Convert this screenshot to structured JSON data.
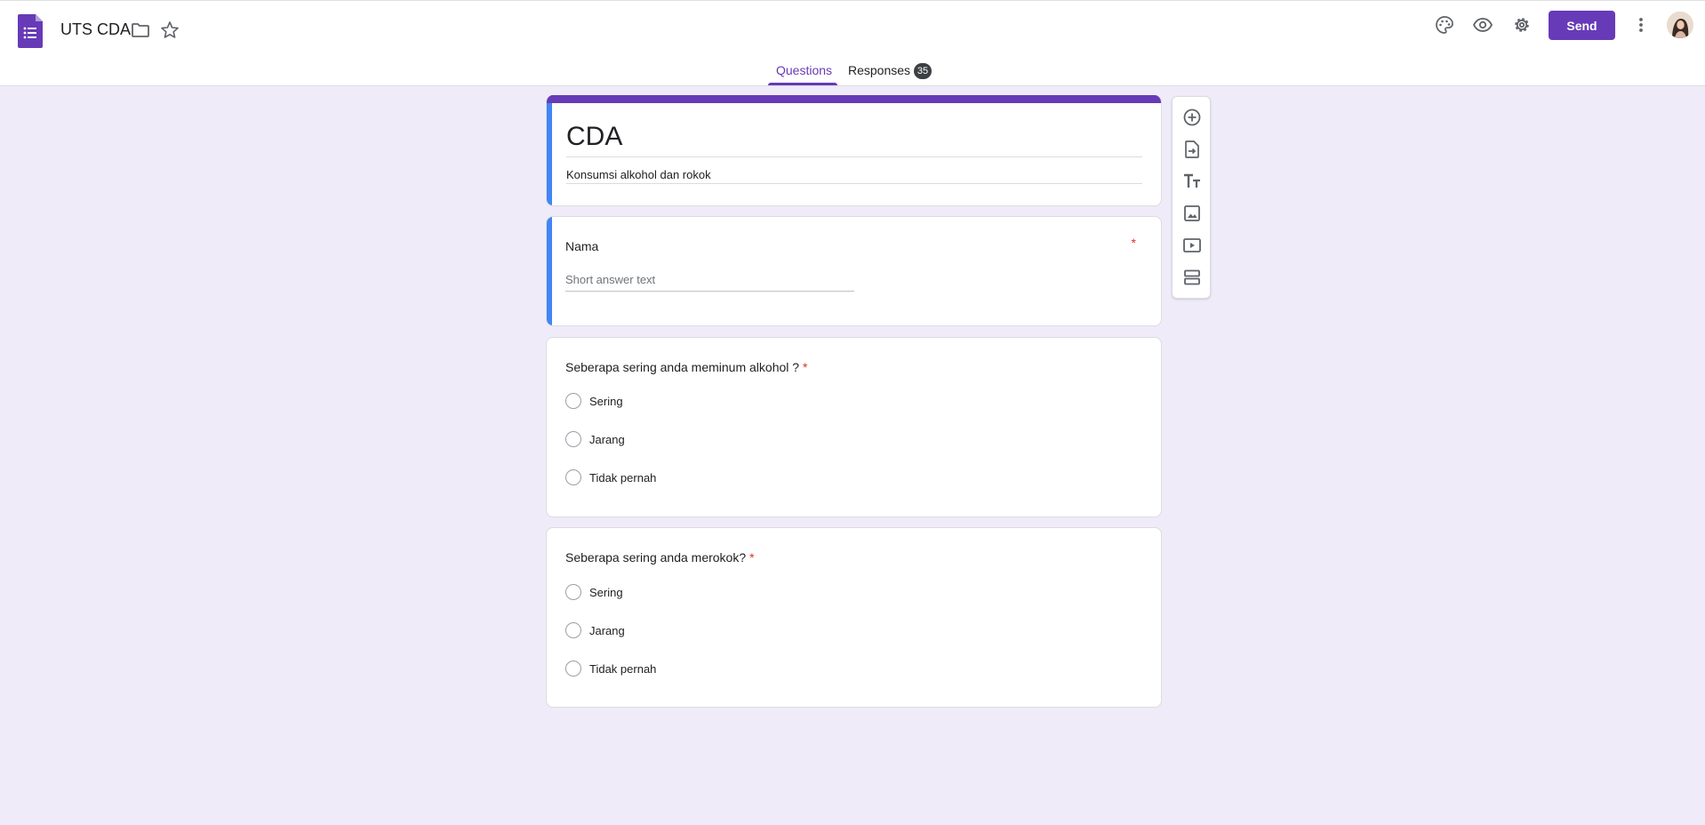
{
  "header": {
    "doc_title": "UTS CDA",
    "send_label": "Send",
    "icons": [
      "forms-logo-icon",
      "folder-icon",
      "star-icon",
      "palette-icon",
      "eye-icon",
      "gear-icon",
      "more-vert-icon"
    ]
  },
  "tabs": {
    "questions": "Questions",
    "responses": "Responses",
    "responses_count": "35"
  },
  "form": {
    "title": "CDA",
    "description": "Konsumsi alkohol dan rokok"
  },
  "questions": [
    {
      "title": "Nama",
      "required_mark": "*",
      "placeholder": "Short answer text"
    },
    {
      "title": "Seberapa sering anda meminum alkohol ?",
      "required_mark": "*",
      "options": [
        "Sering",
        "Jarang",
        "Tidak pernah"
      ]
    },
    {
      "title": "Seberapa sering anda merokok?",
      "required_mark": "*",
      "options": [
        "Sering",
        "Jarang",
        "Tidak pernah"
      ]
    }
  ],
  "toolbar": {
    "icons": [
      "add-question-icon",
      "import-questions-icon",
      "add-title-icon",
      "add-image-icon",
      "add-video-icon",
      "add-section-icon"
    ]
  },
  "colors": {
    "accent": "#673ab7",
    "active_bar": "#4285f4",
    "background": "#f0ebf8",
    "required": "#d93025"
  }
}
